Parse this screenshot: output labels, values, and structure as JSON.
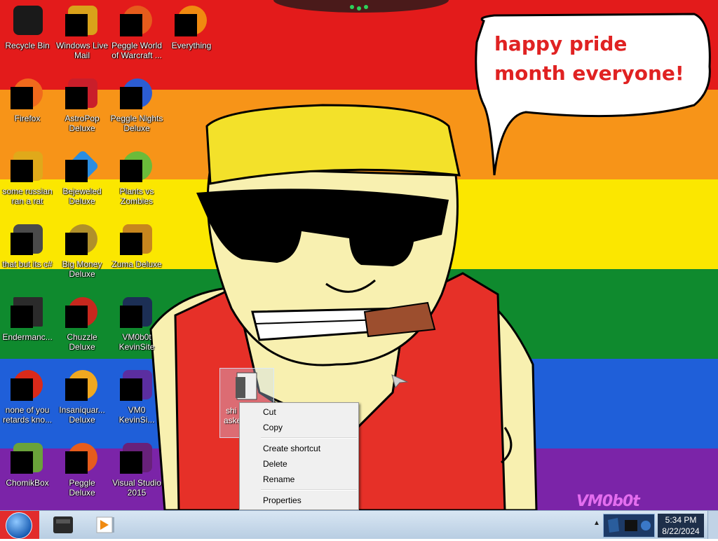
{
  "desktop": {
    "speech_bubble_text": "happy pride month everyone!",
    "watermark": "VM0b0t",
    "icons": [
      {
        "label": "Recycle Bin",
        "icon": "recycle-bin-icon",
        "color": "#1a1a1a"
      },
      {
        "label": "Windows Live Mail",
        "icon": "mail-icon",
        "color": "#d9a21a"
      },
      {
        "label": "Peggle World of Warcraft ...",
        "icon": "peggle-icon",
        "color": "#e65c1c"
      },
      {
        "label": "Everything",
        "icon": "everything-search-icon",
        "color": "#f08a10"
      },
      {
        "label": "Firefox",
        "icon": "firefox-icon",
        "color": "#f06a1c"
      },
      {
        "label": "AstroPop Deluxe",
        "icon": "astropop-icon",
        "color": "#c91e2a"
      },
      {
        "label": "Peggle Nights Deluxe",
        "icon": "peggle-nights-icon",
        "color": "#2c5dd2"
      },
      {
        "label": "some russian ran a rat",
        "icon": "rat-app-icon",
        "color": "#e0a91a"
      },
      {
        "label": "Bejeweled Deluxe",
        "icon": "bejeweled-icon",
        "color": "#2a8de0"
      },
      {
        "label": "Plants vs Zombies",
        "icon": "pvz-icon",
        "color": "#6bbb3a"
      },
      {
        "label": "that but its c#",
        "icon": "windows-stack-icon",
        "color": "#4a4a4a"
      },
      {
        "label": "Big Money Deluxe",
        "icon": "money-bag-icon",
        "color": "#b0902a"
      },
      {
        "label": "Zuma Deluxe",
        "icon": "zuma-icon",
        "color": "#c7861e"
      },
      {
        "label": "Endermanc...",
        "icon": "console-icon",
        "color": "#2b2b2b"
      },
      {
        "label": "Chuzzle Deluxe",
        "icon": "chuzzle-icon",
        "color": "#c8281e"
      },
      {
        "label": "VM0b0t KevinSite",
        "icon": "website-icon",
        "color": "#1c2f55"
      },
      {
        "label": "none of you retards kno...",
        "icon": "app-icon",
        "color": "#d92a1a"
      },
      {
        "label": "Insaniquar... Deluxe",
        "icon": "insaniquarium-icon",
        "color": "#f0a820"
      },
      {
        "label": "VM0 KevinSi...",
        "icon": "vs-file-icon",
        "color": "#5b2ea0"
      },
      {
        "label": "ChomikBox",
        "icon": "chomikbox-icon",
        "color": "#6aa23a"
      },
      {
        "label": "Peggle Deluxe",
        "icon": "peggle-deluxe-icon",
        "color": "#e65c1c"
      },
      {
        "label": "Visual Studio 2015",
        "icon": "visual-studio-icon",
        "color": "#68217a"
      }
    ],
    "selected_icon": {
      "label_line1": "shi",
      "label_line2": "aske",
      "icon": "archive-icon"
    }
  },
  "context_menu": {
    "items": [
      {
        "label": "Cut"
      },
      {
        "label": "Copy"
      },
      {
        "label": "Create shortcut"
      },
      {
        "label": "Delete"
      },
      {
        "label": "Rename"
      },
      {
        "label": "Properties"
      }
    ]
  },
  "taskbar": {
    "time": "5:34 PM",
    "date": "8/22/2024",
    "pinned": [
      {
        "icon": "explorer-icon",
        "color": "#2a2a2a"
      },
      {
        "icon": "media-player-icon",
        "color": "#f08a10"
      }
    ]
  }
}
